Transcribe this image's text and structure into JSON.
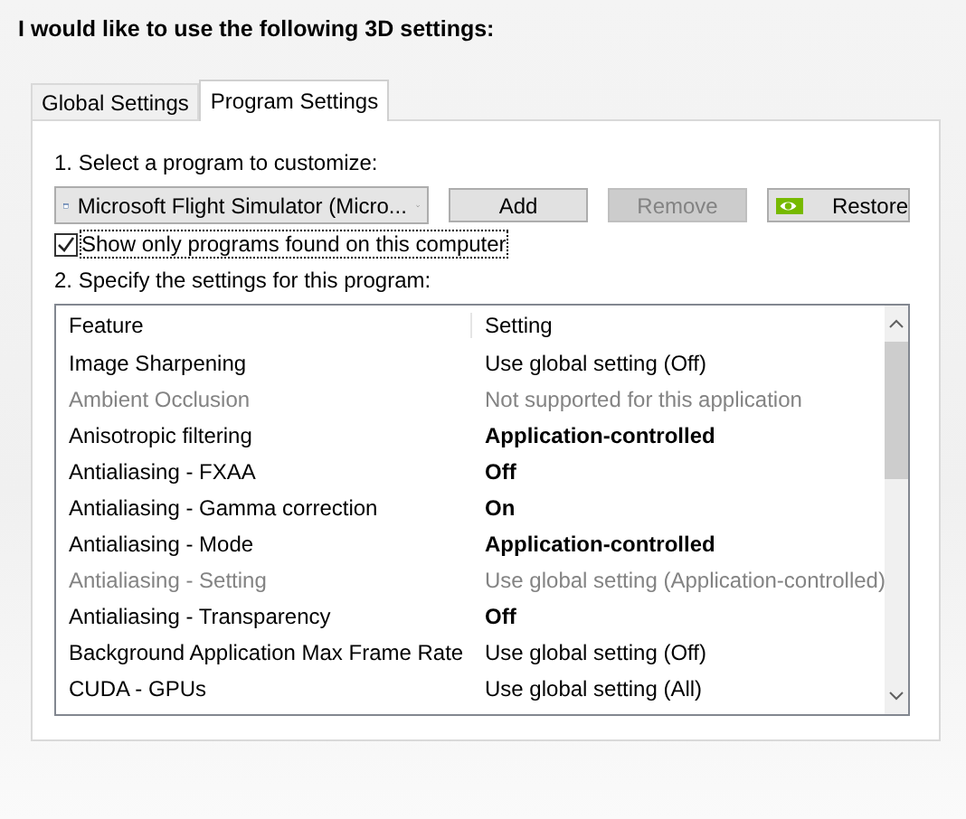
{
  "heading": "I would like to use the following 3D settings:",
  "tabs": [
    {
      "label": "Global Settings",
      "selected": false
    },
    {
      "label": "Program Settings",
      "selected": true
    }
  ],
  "step1": "1. Select a program to customize:",
  "program": {
    "value": "Microsoft Flight Simulator (Micro..."
  },
  "buttons": [
    {
      "label": "Add",
      "disabled": false,
      "kind": "plain"
    },
    {
      "label": "Remove",
      "disabled": true,
      "kind": "plain"
    },
    {
      "label": "Restore",
      "disabled": false,
      "kind": "logo"
    }
  ],
  "show_only": {
    "label": "Show only programs found on this computer",
    "checked": true
  },
  "step2": "2. Specify the settings for this program:",
  "table": {
    "columns": [
      "Feature",
      "Setting"
    ],
    "rows": [
      {
        "feature": "Image Sharpening",
        "setting": "Use global setting (Off)",
        "disabled": false,
        "modified": false
      },
      {
        "feature": "Ambient Occlusion",
        "setting": "Not supported for this application",
        "disabled": true,
        "modified": false
      },
      {
        "feature": "Anisotropic filtering",
        "setting": "Application-controlled",
        "disabled": false,
        "modified": true
      },
      {
        "feature": "Antialiasing - FXAA",
        "setting": "Off",
        "disabled": false,
        "modified": true
      },
      {
        "feature": "Antialiasing - Gamma correction",
        "setting": "On",
        "disabled": false,
        "modified": true
      },
      {
        "feature": "Antialiasing - Mode",
        "setting": "Application-controlled",
        "disabled": false,
        "modified": true
      },
      {
        "feature": "Antialiasing - Setting",
        "setting": "Use global setting (Application-controlled)",
        "disabled": true,
        "modified": false
      },
      {
        "feature": "Antialiasing - Transparency",
        "setting": "Off",
        "disabled": false,
        "modified": true
      },
      {
        "feature": "Background Application Max Frame Rate",
        "setting": "Use global setting (Off)",
        "disabled": false,
        "modified": false
      },
      {
        "feature": "CUDA - GPUs",
        "setting": "Use global setting (All)",
        "disabled": false,
        "modified": false
      }
    ]
  }
}
